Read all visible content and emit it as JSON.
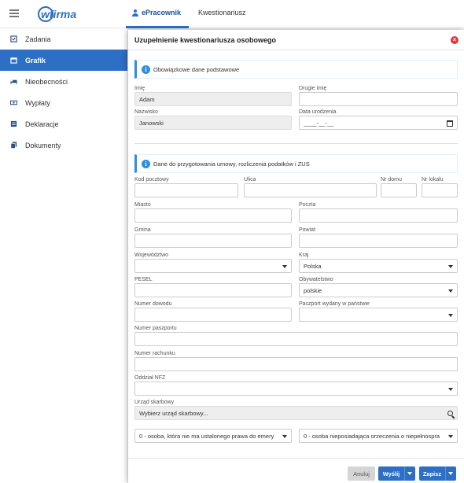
{
  "app": {
    "logo_text": "wfirma",
    "tabs": [
      {
        "label": "ePracownik"
      },
      {
        "label": "Kwestionariusz"
      }
    ]
  },
  "sidebar": {
    "items": [
      {
        "label": "Zadania",
        "icon": "checklist-icon"
      },
      {
        "label": "Grafik",
        "icon": "calendar-icon"
      },
      {
        "label": "Nieobecności",
        "icon": "bed-icon"
      },
      {
        "label": "Wypłaty",
        "icon": "money-icon"
      },
      {
        "label": "Deklaracje",
        "icon": "form-icon"
      },
      {
        "label": "Dokumenty",
        "icon": "documents-icon"
      }
    ]
  },
  "modal": {
    "title": "Uzupełnienie kwestionariusza osobowego",
    "section1": "Obowiązkowe dane podstawowe",
    "section2": "Dane do przygotowania umowy, rozliczenia podatków i ZUS",
    "fields": {
      "imie": {
        "label": "Imię",
        "value": "Adam"
      },
      "drugie_imie": {
        "label": "Drugie imię",
        "value": ""
      },
      "nazwisko": {
        "label": "Nazwisko",
        "value": "Janowski"
      },
      "data_urodzenia": {
        "label": "Data urodzenia",
        "placeholder": "____-__-__"
      },
      "kod_pocztowy": {
        "label": "Kod pocztowy",
        "value": ""
      },
      "ulica": {
        "label": "Ulica",
        "value": ""
      },
      "nr_domu": {
        "label": "Nr domu",
        "value": ""
      },
      "nr_lokalu": {
        "label": "Nr lokalu",
        "value": ""
      },
      "miasto": {
        "label": "Miasto",
        "value": ""
      },
      "poczta": {
        "label": "Poczta",
        "value": ""
      },
      "gmina": {
        "label": "Gmina",
        "value": ""
      },
      "powiat": {
        "label": "Powiat",
        "value": ""
      },
      "wojewodztwo": {
        "label": "Województwo",
        "value": ""
      },
      "kraj": {
        "label": "Kraj",
        "value": "Polska"
      },
      "pesel": {
        "label": "PESEL",
        "value": ""
      },
      "obywatelstwo": {
        "label": "Obywatelstwo",
        "value": "polskie"
      },
      "numer_dowodu": {
        "label": "Numer dowodu",
        "value": ""
      },
      "paszport_panstwo": {
        "label": "Paszport wydany w państwie",
        "value": ""
      },
      "numer_paszportu": {
        "label": "Numer paszportu",
        "value": ""
      },
      "numer_rachunku": {
        "label": "Numer rachunku",
        "value": ""
      },
      "oddzial_nfz": {
        "label": "Oddział NFZ",
        "value": ""
      },
      "urzad_skarbowy": {
        "label": "Urząd skarbowy",
        "placeholder": "Wybierz urząd skarbowy..."
      },
      "prawo_emerytury": {
        "value": "0 - osoba, która nie ma ustalonego prawa do emery"
      },
      "niepelnosprawnosc": {
        "value": "0 - osoba nieposiadająca orzeczenia o niepełnospra"
      }
    },
    "buttons": {
      "anuluj": "Anuluj",
      "wyslij": "Wyślij",
      "zapisz": "Zapisz"
    }
  },
  "colors": {
    "accent": "#2d6fc4",
    "info": "#2d8fe0",
    "close": "#e53935"
  }
}
